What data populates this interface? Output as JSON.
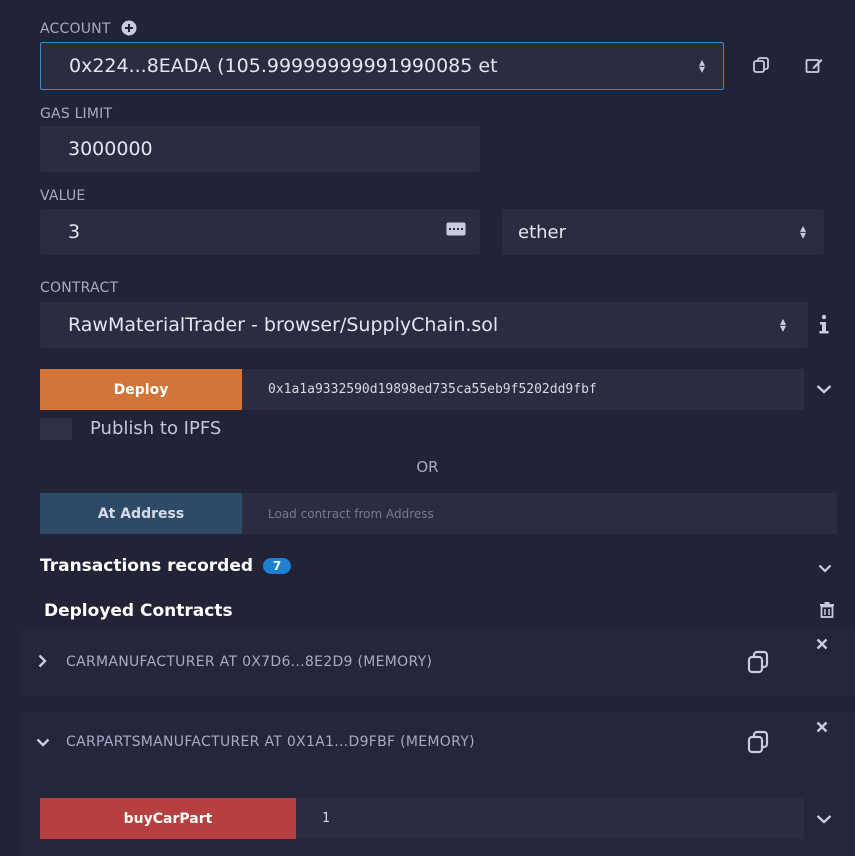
{
  "account": {
    "label": "ACCOUNT",
    "value": "0x224...8EADA (105.99999999991990085 et"
  },
  "gas_limit": {
    "label": "GAS LIMIT",
    "value": "3000000"
  },
  "value": {
    "label": "VALUE",
    "amount": "3",
    "unit": "ether"
  },
  "contract": {
    "label": "CONTRACT",
    "selected": "RawMaterialTrader - browser/SupplyChain.sol"
  },
  "deploy": {
    "button_label": "Deploy",
    "args": "0x1a1a9332590d19898ed735ca55eb9f5202dd9fbf"
  },
  "publish": {
    "label": "Publish to IPFS",
    "checked": false
  },
  "or_label": "OR",
  "at_address": {
    "button_label": "At Address",
    "placeholder": "Load contract from Address"
  },
  "transactions": {
    "label": "Transactions recorded",
    "count": "7"
  },
  "deployed": {
    "label": "Deployed Contracts",
    "items": [
      {
        "title": "CARMANUFACTURER AT 0X7D6...8E2D9 (MEMORY)",
        "expanded": false
      },
      {
        "title": "CARPARTSMANUFACTURER AT 0X1A1...D9FBF (MEMORY)",
        "expanded": true
      }
    ]
  },
  "function": {
    "button_label": "buyCarPart",
    "arg": "1"
  },
  "colors": {
    "background": "#222336",
    "field": "#2a2c3f",
    "deploy": "#d2753a",
    "at_address": "#2f4a66",
    "payable_function": "#b5403f",
    "badge": "#1f7fd1"
  }
}
